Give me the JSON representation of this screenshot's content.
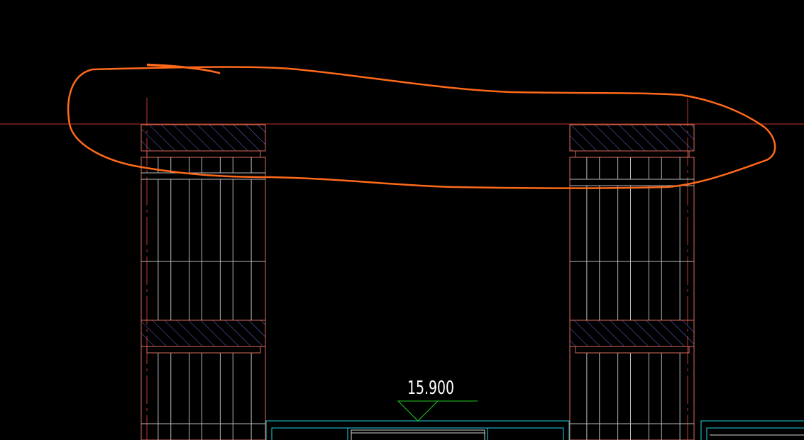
{
  "canvas": {
    "background": "#000000",
    "colors": {
      "axis_line": "#c0392b",
      "column_outline": "#d96a5a",
      "column_inner": "#b8b8b8",
      "hatch": "#6666dd",
      "elevation_marker": "#22c922",
      "elevation_text": "#ffffff",
      "window": "#22d0e0",
      "markup": "#ff6a1a"
    }
  },
  "elevation_label": {
    "text": "15.900",
    "icon": "elevation-triangle-icon"
  },
  "markup_annotation": {
    "shape": "freehand-ellipse",
    "color": "#ff6a1a"
  }
}
